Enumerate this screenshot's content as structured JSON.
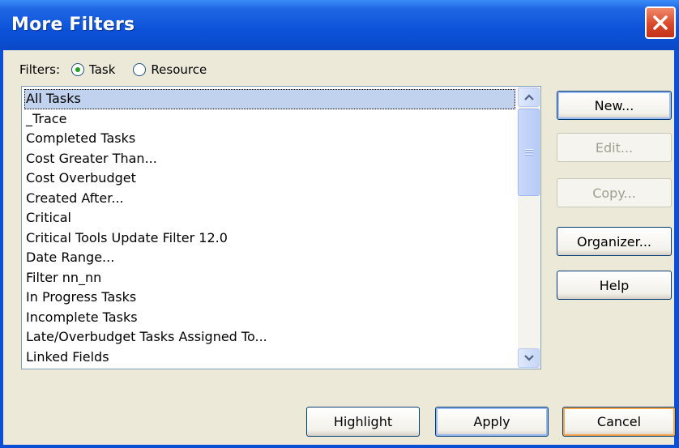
{
  "window": {
    "title": "More Filters"
  },
  "filters": {
    "label": "Filters:",
    "options": [
      {
        "label": "Task",
        "checked": true
      },
      {
        "label": "Resource",
        "checked": false
      }
    ]
  },
  "list": {
    "items": [
      "All Tasks",
      "_Trace",
      "Completed Tasks",
      "Cost Greater Than...",
      "Cost Overbudget",
      "Created After...",
      "Critical",
      "Critical Tools Update Filter 12.0",
      "Date Range...",
      "Filter nn_nn",
      "In Progress Tasks",
      "Incomplete Tasks",
      "Late/Overbudget Tasks Assigned To...",
      "Linked Fields"
    ],
    "selected_index": 0
  },
  "side_buttons": {
    "new": "New...",
    "edit": "Edit...",
    "copy": "Copy...",
    "organizer": "Organizer...",
    "help": "Help"
  },
  "bottom_buttons": {
    "highlight": "Highlight",
    "apply": "Apply",
    "cancel": "Cancel"
  },
  "colors": {
    "titlebar": "#0a52d9",
    "close_button": "#d9482a",
    "dialog_background": "#ece9d8",
    "selection": "#c1d2ee"
  }
}
